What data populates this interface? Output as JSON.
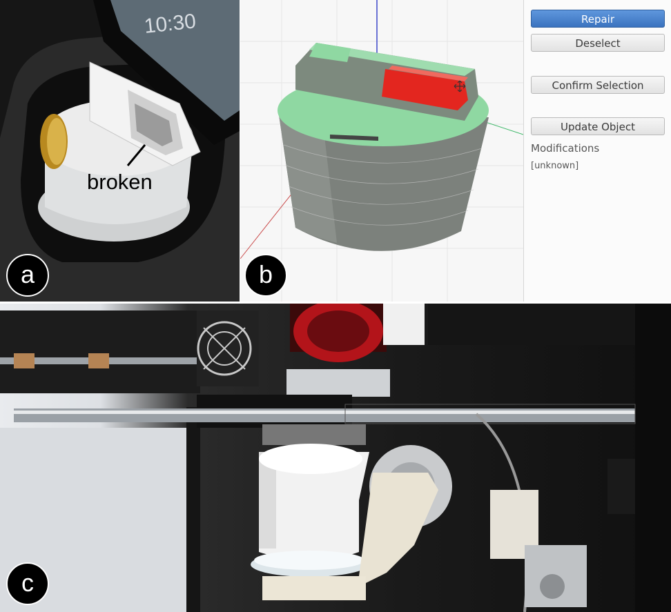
{
  "panel_a": {
    "badge": "a",
    "annotation": "broken"
  },
  "panel_b": {
    "badge": "b",
    "sidebar": {
      "repair_label": "Repair",
      "deselect_label": "Deselect",
      "confirm_selection_label": "Confirm Selection",
      "update_object_label": "Update Object",
      "modifications_title": "Modifications",
      "modifications_value": "[unknown]"
    }
  },
  "panel_c": {
    "badge": "c"
  },
  "colors": {
    "selection_red": "#e3261f",
    "model_gray": "#7f847f",
    "model_green": "#8fd6a0",
    "primary_button": "#4a82cc"
  }
}
